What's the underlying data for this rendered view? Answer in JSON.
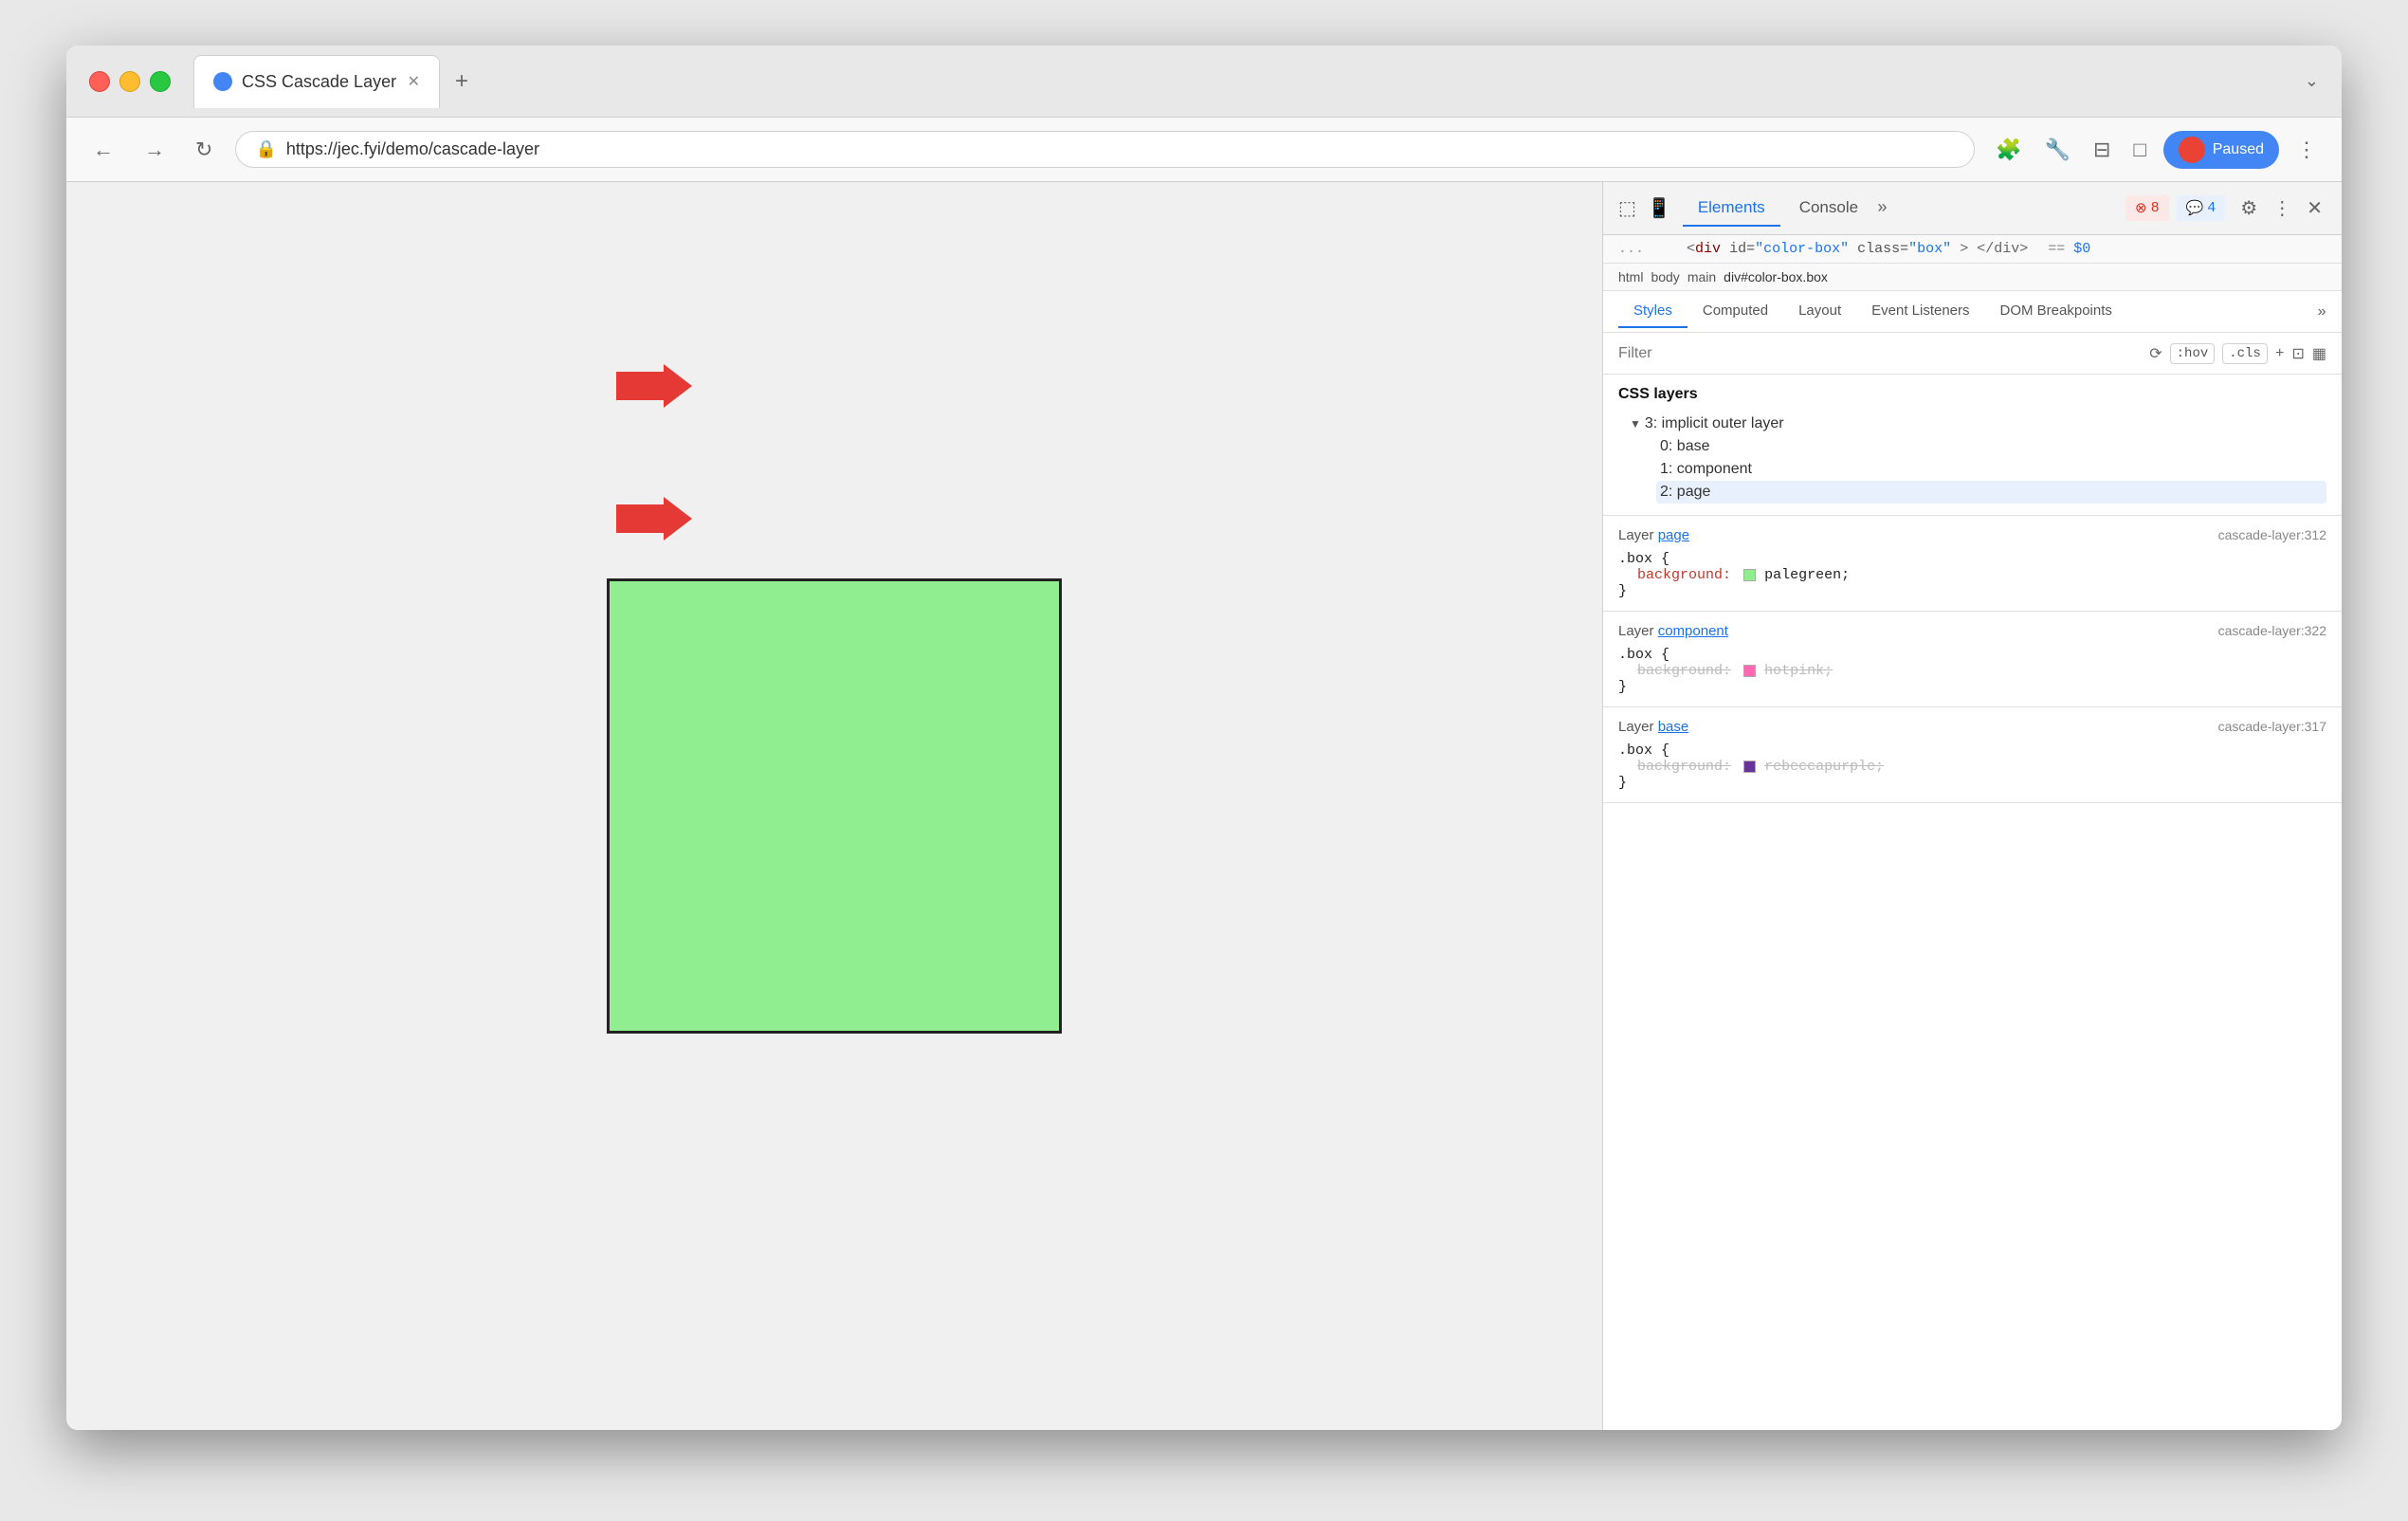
{
  "window": {
    "title": "CSS Cascade Layer"
  },
  "browser": {
    "url": "https://jec.fyi/demo/cascade-layer",
    "tab_title": "CSS Cascade Layer",
    "paused_label": "Paused"
  },
  "devtools": {
    "tabs": [
      "Elements",
      "Console"
    ],
    "active_tab": "Elements",
    "error_count": "8",
    "warning_count": "4"
  },
  "breadcrumb": {
    "items": [
      "html",
      "body",
      "main",
      "div#color-box.box"
    ]
  },
  "html_element": {
    "display": "<div id=\"color-box\" class=\"box\"> </div> == $0"
  },
  "styles_tabs": {
    "items": [
      "Styles",
      "Computed",
      "Layout",
      "Event Listeners",
      "DOM Breakpoints"
    ]
  },
  "filter": {
    "placeholder": "Filter",
    "hov_label": ":hov",
    "cls_label": ".cls"
  },
  "css_layers": {
    "title": "CSS layers",
    "tree": {
      "root": "3: implicit outer layer",
      "children": [
        "0: base",
        "1: component",
        "2: page"
      ]
    },
    "selected_child": "2: page"
  },
  "layer_page": {
    "label": "Layer",
    "link": "page",
    "selector": ".box {",
    "property": "background:",
    "swatch_color": "#90ee90",
    "value": "palegreen;",
    "close": "}",
    "source": "cascade-layer:312"
  },
  "layer_component": {
    "label": "Layer",
    "link": "component",
    "selector": ".box {",
    "property": "background:",
    "swatch_color": "#ff69b4",
    "value": "hotpink;",
    "close": "}",
    "source": "cascade-layer:322"
  },
  "layer_base": {
    "label": "Layer",
    "link": "base",
    "selector": ".box {",
    "property": "background:",
    "swatch_color": "#663399",
    "value": "rebeccapurple;",
    "close": "}",
    "source": "cascade-layer:317"
  },
  "arrows": {
    "first_label": "→",
    "second_label": "→"
  }
}
